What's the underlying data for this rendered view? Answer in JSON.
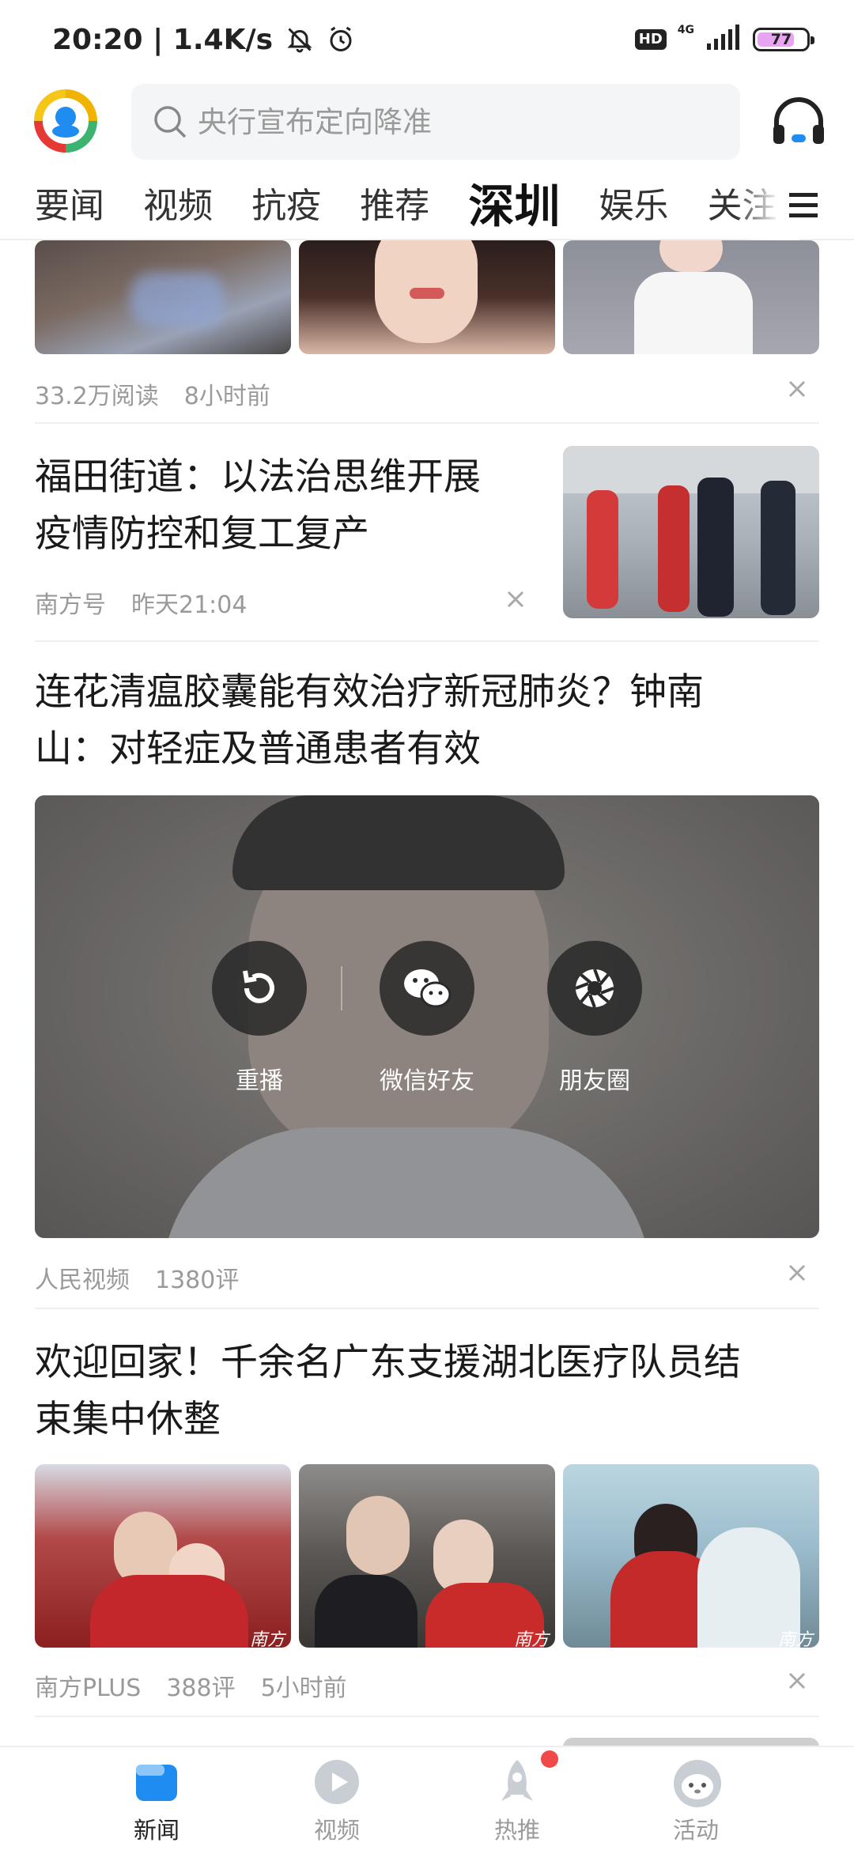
{
  "status_bar": {
    "time_speed": "20:20 | 1.4K/s",
    "hd": "HD",
    "network": "4G",
    "battery": "77",
    "battery_level": 0.77
  },
  "header": {
    "search_placeholder": "央行宣布定向降准"
  },
  "tabs": [
    {
      "label": "要闻",
      "active": false
    },
    {
      "label": "视频",
      "active": false
    },
    {
      "label": "抗疫",
      "active": false
    },
    {
      "label": "推荐",
      "active": false
    },
    {
      "label": "深圳",
      "active": true
    },
    {
      "label": "娱乐",
      "active": false
    },
    {
      "label": "关注",
      "active": false
    }
  ],
  "feed": {
    "item1": {
      "reads": "33.2万阅读",
      "time": "8小时前"
    },
    "item2": {
      "title_line1": "福田街道：以法治思维开展",
      "title_line2": "疫情防控和复工复产",
      "source": "南方号",
      "time": "昨天21:04"
    },
    "item3": {
      "title_line1": "连花清瘟胶囊能有效治疗新冠肺炎？钟南",
      "title_line2": "山：对轻症及普通患者有效",
      "replay_label": "重播",
      "wechat_label": "微信好友",
      "moments_label": "朋友圈",
      "source": "人民视频",
      "comments": "1380评"
    },
    "item4": {
      "title_line1": "欢迎回家！千余名广东支援湖北医疗队员结",
      "title_line2": "束集中休整",
      "source": "南方PLUS",
      "comments": "388评",
      "time": "5小时前",
      "watermark": "南方+"
    }
  },
  "bottom_nav": [
    {
      "label": "新闻",
      "icon": "news-icon",
      "active": true
    },
    {
      "label": "视频",
      "icon": "video-play-icon",
      "active": false
    },
    {
      "label": "热推",
      "icon": "rocket-icon",
      "active": false,
      "badge": true
    },
    {
      "label": "活动",
      "icon": "activity-avatar-icon",
      "active": false
    }
  ],
  "colors": {
    "accent_blue": "#1e8cf0",
    "badge_red": "#f04a4a",
    "meta_gray": "#9a9a9a"
  }
}
